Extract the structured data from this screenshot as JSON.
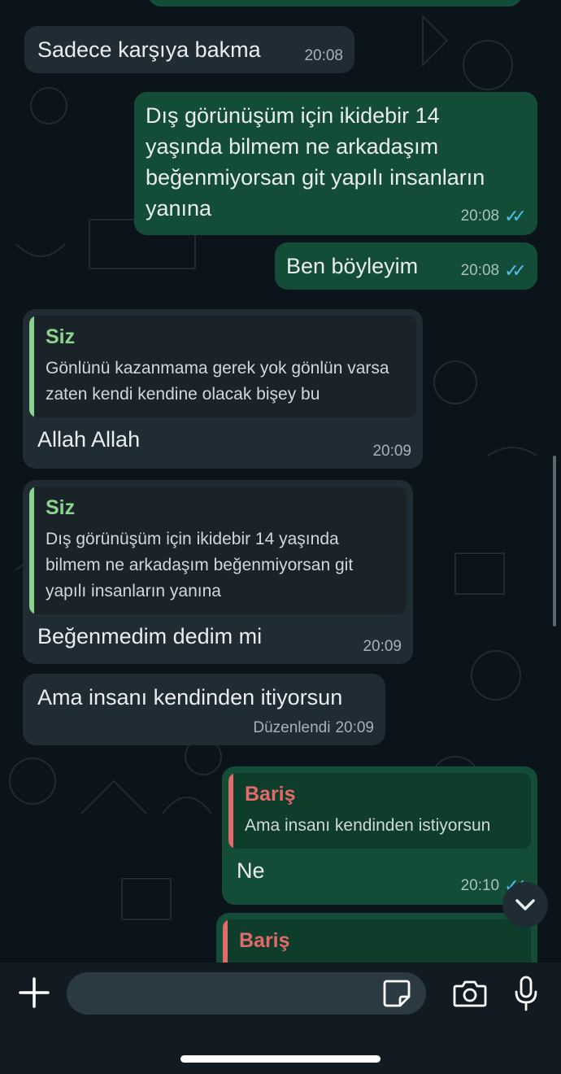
{
  "messages": [
    {
      "text": "Sadece karşıya bakma",
      "time": "20:08"
    },
    {
      "text": "Dış görünüşüm için ikidebir 14 yaşında bilmem ne arkadaşım beğenmiyorsan git yapılı insanların yanına",
      "time": "20:08"
    },
    {
      "text": "Ben böyleyim",
      "time": "20:08"
    },
    {
      "quote_name": "Siz",
      "quote_text": "Gönlünü kazanmama gerek yok gönlün varsa zaten kendi kendine olacak bişey bu",
      "text": "Allah Allah",
      "time": "20:09"
    },
    {
      "quote_name": "Siz",
      "quote_text": "Dış görünüşüm için ikidebir 14 yaşında bilmem ne arkadaşım beğenmiyorsan git yapılı insanların yanına",
      "text": "Beğenmedim dedim mi",
      "time": "20:09"
    },
    {
      "text": "Ama insanı kendinden itiyorsun",
      "edited": "Düzenlendi",
      "time": "20:09"
    },
    {
      "quote_name": "Bariş",
      "quote_text": "Ama insanı kendinden istiyorsun",
      "text": "Ne",
      "time": "20:10"
    },
    {
      "quote_name": "Bariş"
    }
  ],
  "icons": {
    "plus": "plus-icon",
    "sticker": "sticker-icon",
    "camera": "camera-icon",
    "mic": "microphone-icon",
    "scroll": "chevron-down-icon",
    "read": "double-check-icon"
  },
  "colors": {
    "background": "#0b141a",
    "incoming": "#202c33",
    "outgoing": "#144d37",
    "quote_self": "#8bd38e",
    "quote_other": "#e26a6a",
    "read_ticks": "#53bdeb"
  }
}
